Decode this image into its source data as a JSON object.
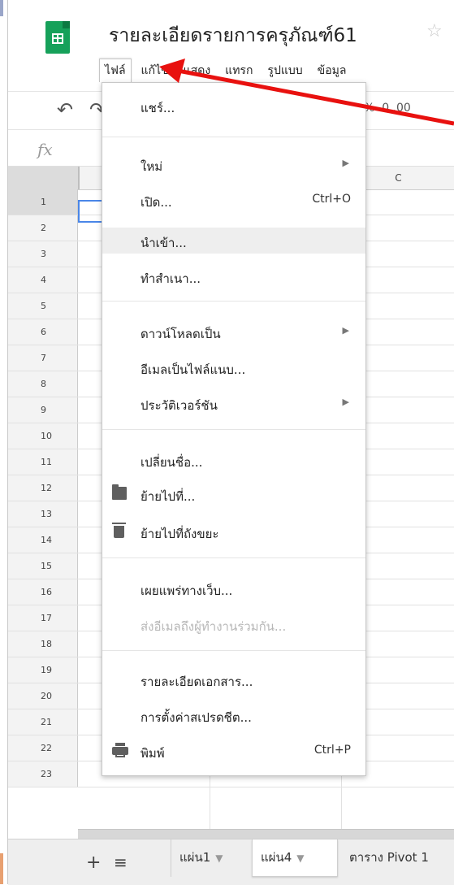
{
  "document": {
    "title": "รายละเอียดรายการครุภัณฑ์61",
    "star_icon": "star-icon"
  },
  "menubar": [
    "ไฟล์",
    "แก้ไข",
    "แสดง",
    "แทรก",
    "รูปแบบ",
    "ข้อมูล"
  ],
  "toolbar": {
    "format_buttons": "% .0 .00"
  },
  "formula_bar": {
    "fx_label": "fx"
  },
  "grid": {
    "column_visible": "C",
    "rows": [
      "1",
      "2",
      "3",
      "4",
      "5",
      "6",
      "7",
      "8",
      "9",
      "10",
      "11",
      "12",
      "13",
      "14",
      "15",
      "16",
      "17",
      "18",
      "19",
      "20",
      "21",
      "22",
      "23"
    ]
  },
  "file_menu": {
    "share": "แชร์...",
    "new": "ใหม่",
    "open": "เปิด...",
    "open_shortcut": "Ctrl+O",
    "import": "นำเข้า...",
    "make_copy": "ทำสำเนา...",
    "download_as": "ดาวน์โหลดเป็น",
    "email_as_attachment": "อีเมลเป็นไฟล์แนบ...",
    "version_history": "ประวัติเวอร์ชัน",
    "rename": "เปลี่ยนชื่อ...",
    "move_to": "ย้ายไปที่...",
    "move_to_trash": "ย้ายไปที่ถังขยะ",
    "publish_to_web": "เผยแพร่ทางเว็บ...",
    "email_collaborators": "ส่งอีเมลถึงผู้ทำงานร่วมกัน...",
    "document_details": "รายละเอียดเอกสาร...",
    "spreadsheet_settings": "การตั้งค่าสเปรดชีต...",
    "print": "พิมพ์",
    "print_shortcut": "Ctrl+P"
  },
  "sheet_tabs": {
    "tab1": "แผ่น1",
    "tab2": "แผ่น4",
    "tab3": "ตาราง Pivot 1"
  },
  "annotation": {
    "arrow_color": "#e8110f"
  },
  "colors": {
    "brand_green": "#16a15a",
    "selection_blue": "#4a86e8"
  }
}
